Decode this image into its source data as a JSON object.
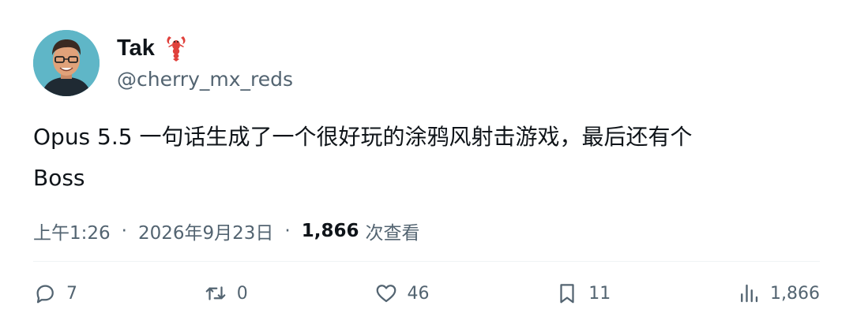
{
  "user": {
    "display_name": "Tak",
    "emoji_icon": "lobster-emoji-icon",
    "handle": "@cherry_mx_reds"
  },
  "tweet": {
    "text_line1": "Opus 5.5 一句话生成了一个很好玩的涂鸦风射击游戏，最后还有个",
    "text_line2": "Boss"
  },
  "meta": {
    "time": "上午1:26",
    "date": "2026年9月23日",
    "separator": "·",
    "views_count": "1,866",
    "views_label": "次查看"
  },
  "actions": {
    "replies": "7",
    "retweets": "0",
    "likes": "46",
    "bookmarks": "11",
    "views": "1,866"
  },
  "colors": {
    "text": "#0f1419",
    "secondary": "#536471",
    "divider": "#eff3f4",
    "lobster": "#e0413c"
  }
}
